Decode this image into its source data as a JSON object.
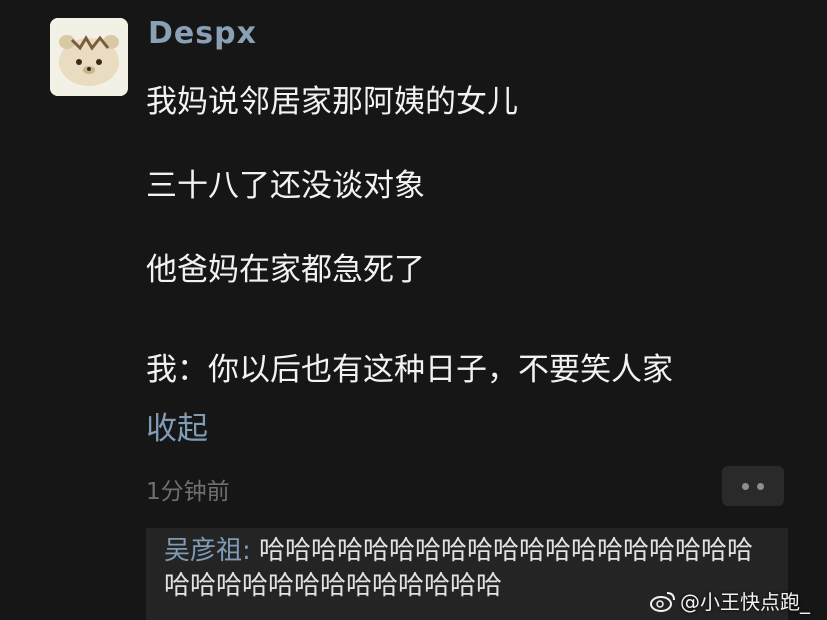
{
  "post": {
    "username": "Despx",
    "lines": [
      "我妈说邻居家那阿姨的女儿",
      "三十八了还没谈对象",
      "他爸妈在家都急死了",
      "我：你以后也有这种日子，不要笑人家"
    ],
    "collapse_label": "收起",
    "time": "1分钟前",
    "avatar_icon": "bear-avatar-icon",
    "more_icon": "more-dots-icon"
  },
  "reply": {
    "user": "吴彦祖:",
    "text": "哈哈哈哈哈哈哈哈哈哈哈哈哈哈哈哈哈哈哈哈哈哈哈哈哈哈哈哈哈哈哈哈"
  },
  "watermark": {
    "text": "@小王快点跑_",
    "icon": "weibo-icon"
  },
  "colors": {
    "background": "#161616",
    "username": "#8aa0b4",
    "link": "#7f9bb6",
    "reply_bg": "#242424"
  }
}
